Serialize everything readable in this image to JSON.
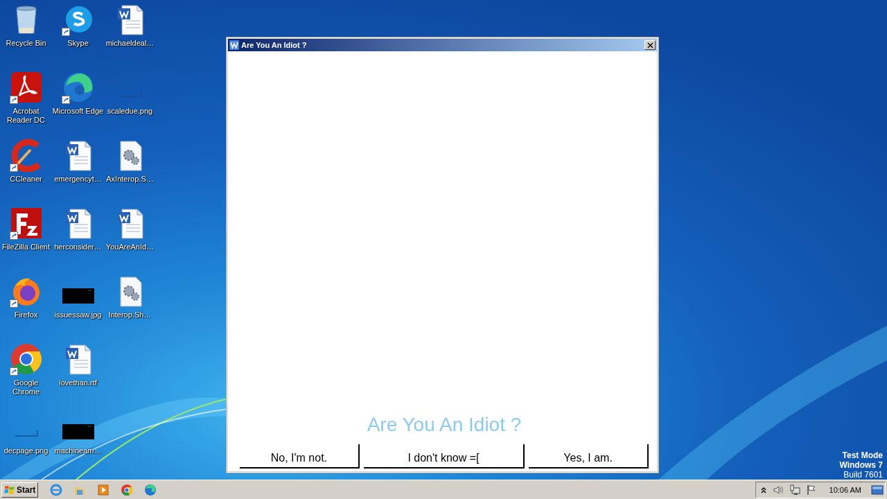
{
  "desktop": {
    "icon_rows": [
      [
        {
          "label": "Recycle Bin",
          "kind": "bin",
          "shortcut": false
        },
        {
          "label": "Skype",
          "kind": "skype",
          "shortcut": true
        },
        {
          "label": "michaeldeal…",
          "kind": "word-doc",
          "shortcut": false
        }
      ],
      [
        {
          "label": "Acrobat Reader DC",
          "kind": "acrobat",
          "shortcut": true
        },
        {
          "label": "Microsoft Edge",
          "kind": "edge",
          "shortcut": true
        },
        {
          "label": "scaledue.png",
          "kind": "blank-image",
          "shortcut": false
        }
      ],
      [
        {
          "label": "CCleaner",
          "kind": "ccleaner",
          "shortcut": true
        },
        {
          "label": "emergencyt…",
          "kind": "word-doc",
          "shortcut": false
        },
        {
          "label": "AxInterop.S…",
          "kind": "gear-doc",
          "shortcut": false
        }
      ],
      [
        {
          "label": "FileZilla Client",
          "kind": "filezilla",
          "shortcut": true
        },
        {
          "label": "herconsider…",
          "kind": "word-doc",
          "shortcut": false
        },
        {
          "label": "YouAreAnId…",
          "kind": "word",
          "shortcut": false
        }
      ],
      [
        {
          "label": "Firefox",
          "kind": "firefox",
          "shortcut": true
        },
        {
          "label": "issuessaw.jpg",
          "kind": "black-image",
          "shortcut": false
        },
        {
          "label": "Interop.Sh…",
          "kind": "gear-doc",
          "shortcut": false
        }
      ],
      [
        {
          "label": "Google Chrome",
          "kind": "chrome",
          "shortcut": true
        },
        {
          "label": "lovethan.rtf",
          "kind": "word-doc",
          "shortcut": false
        }
      ],
      [
        {
          "label": "decpage.png",
          "kind": "blank-image",
          "shortcut": false
        },
        {
          "label": "machineam…",
          "kind": "black-image",
          "shortcut": false
        }
      ]
    ]
  },
  "window": {
    "title": "Are You An Idiot ?",
    "heading": "Are You An Idiot ?",
    "buttons": [
      "No, I'm not.",
      "I don't know =[",
      "Yes, I am."
    ]
  },
  "system_notice": [
    {
      "text": "Test Mode",
      "bold": true
    },
    {
      "text": "Windows 7",
      "bold": true
    },
    {
      "text": "Build 7601",
      "bold": false
    }
  ],
  "taskbar": {
    "start": "Start",
    "pinned": [
      {
        "kind": "ie"
      },
      {
        "kind": "folder"
      },
      {
        "kind": "media"
      },
      {
        "kind": "chrome"
      },
      {
        "kind": "edge"
      }
    ],
    "time": "10:06 AM"
  }
}
